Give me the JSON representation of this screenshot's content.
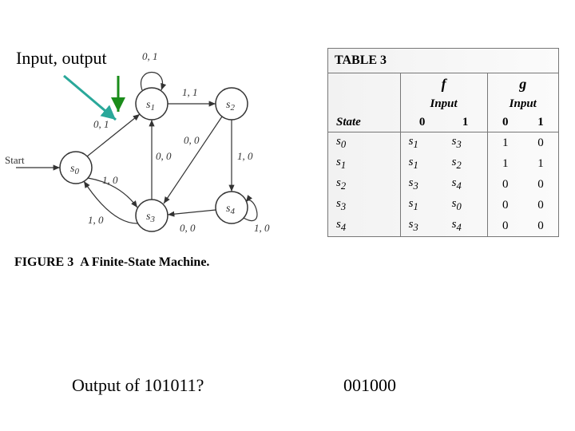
{
  "labels": {
    "input_output": "Input, output",
    "figure_label": "FIGURE 3",
    "figure_title": "A Finite-State Machine.",
    "start": "Start",
    "question": "Output of 101011?",
    "answer": "001000"
  },
  "fsm": {
    "states": [
      "s0",
      "s1",
      "s2",
      "s3",
      "s4"
    ],
    "edges": [
      {
        "from": "s1",
        "to": "s1",
        "label": "0, 1",
        "type": "self_top"
      },
      {
        "from": "s1",
        "to": "s2",
        "label": "1, 1"
      },
      {
        "from": "s0",
        "to": "s1",
        "label": "0, 1"
      },
      {
        "from": "s3",
        "to": "s1",
        "label": "0, 0"
      },
      {
        "from": "s2",
        "to": "s3",
        "label": "0, 0"
      },
      {
        "from": "s2",
        "to": "s4",
        "label": "1, 0"
      },
      {
        "from": "s0",
        "to": "s3",
        "label": "1, 0"
      },
      {
        "from": "s3",
        "to": "s0",
        "label": "1, 0"
      },
      {
        "from": "s4",
        "to": "s3",
        "label": "0, 0"
      },
      {
        "from": "s4",
        "to": "s4",
        "label": "1, 0",
        "type": "self_bottom_right"
      }
    ]
  },
  "table": {
    "title": "TABLE 3",
    "col_state": "State",
    "col_f": "f",
    "col_g": "g",
    "col_input": "Input",
    "col_0": "0",
    "col_1": "1",
    "rows": [
      {
        "state": "s0",
        "f0": "s1",
        "f1": "s3",
        "g0": "1",
        "g1": "0"
      },
      {
        "state": "s1",
        "f0": "s1",
        "f1": "s2",
        "g0": "1",
        "g1": "1"
      },
      {
        "state": "s2",
        "f0": "s3",
        "f1": "s4",
        "g0": "0",
        "g1": "0"
      },
      {
        "state": "s3",
        "f0": "s1",
        "f1": "s0",
        "g0": "0",
        "g1": "0"
      },
      {
        "state": "s4",
        "f0": "s3",
        "f1": "s4",
        "g0": "0",
        "g1": "0"
      }
    ]
  }
}
